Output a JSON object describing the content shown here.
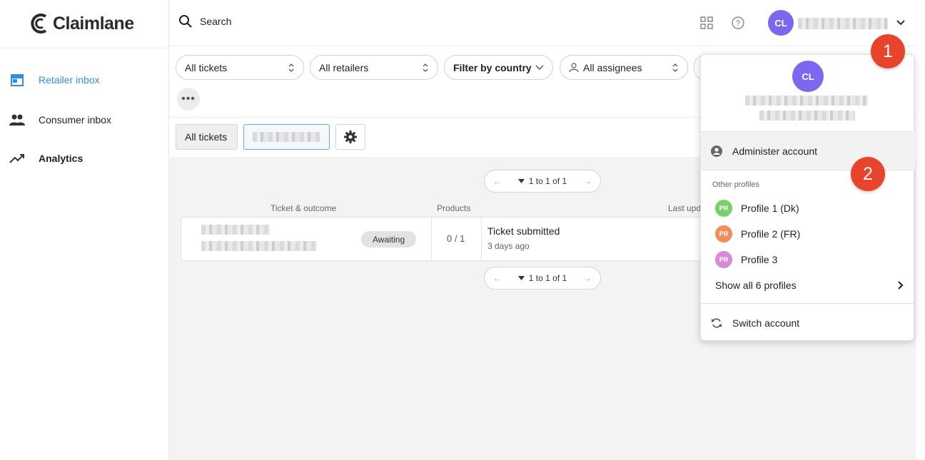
{
  "app": {
    "logo_text": "Claimlane"
  },
  "sidebar": {
    "items": [
      {
        "label": "Retailer inbox",
        "icon": "store-icon"
      },
      {
        "label": "Consumer inbox",
        "icon": "people-icon"
      },
      {
        "label": "Analytics",
        "icon": "trending-up-icon"
      }
    ]
  },
  "header": {
    "search_label": "Search",
    "avatar_initials": "CL"
  },
  "filters": {
    "tickets": "All tickets",
    "retailers": "All retailers",
    "country": "Filter by country",
    "assignees": "All assignees"
  },
  "tabs": {
    "all_tickets": "All tickets"
  },
  "pagination": {
    "text": "1 to 1 of 1"
  },
  "table": {
    "headers": {
      "ticket": "Ticket & outcome",
      "products": "Products",
      "last_update": "Last upd"
    },
    "rows": [
      {
        "status": "Awaiting",
        "products": "0 / 1",
        "update_title": "Ticket submitted",
        "update_time": "3 days ago"
      }
    ]
  },
  "account_menu": {
    "avatar_initials": "CL",
    "administer_label": "Administer account",
    "other_profiles_heading": "Other profiles",
    "profiles": [
      {
        "initials": "PR",
        "name": "Profile 1 (Dk)",
        "color": "#7ccf6e"
      },
      {
        "initials": "PR",
        "name": "Profile 2 (FR)",
        "color": "#ef8d5c"
      },
      {
        "initials": "PR",
        "name": "Profile 3",
        "color": "#d88ad6"
      }
    ],
    "show_all_label": "Show all 6 profiles",
    "switch_label": "Switch account"
  },
  "annotations": {
    "step1": "1",
    "step2": "2"
  },
  "colors": {
    "accent": "#2f8de4",
    "avatar": "#7b68ee",
    "step_badge": "#e8442b"
  }
}
